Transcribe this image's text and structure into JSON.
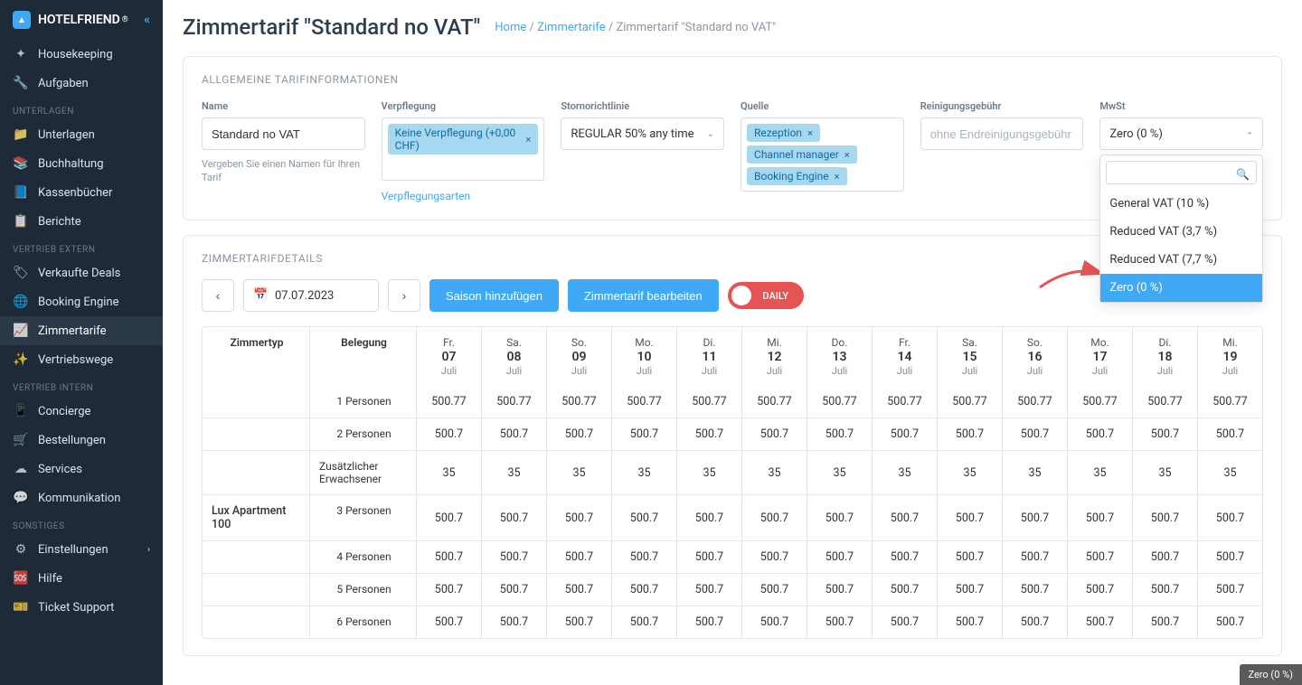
{
  "brand": "HOTELFRIEND",
  "sidebar": {
    "items": [
      {
        "icon": "✦",
        "label": "Housekeeping"
      },
      {
        "icon": "🔧",
        "label": "Aufgaben"
      }
    ],
    "sections": [
      {
        "title": "UNTERLAGEN",
        "items": [
          {
            "icon": "📁",
            "label": "Unterlagen"
          },
          {
            "icon": "📚",
            "label": "Buchhaltung"
          },
          {
            "icon": "📘",
            "label": "Kassenbücher"
          },
          {
            "icon": "📋",
            "label": "Berichte"
          }
        ]
      },
      {
        "title": "VERTRIEB EXTERN",
        "items": [
          {
            "icon": "🏷",
            "label": "Verkaufte Deals"
          },
          {
            "icon": "🌐",
            "label": "Booking Engine"
          },
          {
            "icon": "📈",
            "label": "Zimmertarife",
            "active": true
          },
          {
            "icon": "✨",
            "label": "Vertriebswege"
          }
        ]
      },
      {
        "title": "VERTRIEB INTERN",
        "items": [
          {
            "icon": "📱",
            "label": "Concierge"
          },
          {
            "icon": "🛒",
            "label": "Bestellungen"
          },
          {
            "icon": "☁",
            "label": "Services"
          },
          {
            "icon": "💬",
            "label": "Kommunikation"
          }
        ]
      },
      {
        "title": "SONSTIGES",
        "items": [
          {
            "icon": "⚙",
            "label": "Einstellungen",
            "chevron": true
          },
          {
            "icon": "🆘",
            "label": "Hilfe"
          },
          {
            "icon": "🎫",
            "label": "Ticket Support"
          }
        ]
      }
    ]
  },
  "page": {
    "title": "Zimmertarif \"Standard no VAT\"",
    "breadcrumb": {
      "home": "Home",
      "l1": "Zimmertarife",
      "l2": "Zimmertarif \"Standard no VAT\""
    }
  },
  "panel1": {
    "title": "ALLGEMEINE TARIFINFORMATIONEN",
    "name_label": "Name",
    "name_value": "Standard no VAT",
    "name_hint": "Vergeben Sie einen Namen für Ihren Tarif",
    "meal_label": "Verpflegung",
    "meal_tag": "Keine Verpflegung (+0,00 CHF)",
    "meal_link": "Verpflegungsarten",
    "cancel_label": "Stornorichtlinie",
    "cancel_value": "REGULAR 50% any time",
    "source_label": "Quelle",
    "source_tags": [
      "Rezeption",
      "Channel manager",
      "Booking Engine"
    ],
    "clean_label": "Reinigungsgebühr",
    "clean_placeholder": "ohne Endreinigungsgebühr",
    "vat_label": "MwSt",
    "vat_value": "Zero (0 %)",
    "vat_options": [
      "General VAT (10 %)",
      "Reduced VAT (3,7 %)",
      "Reduced VAT (7,7 %)",
      "Zero (0 %)"
    ]
  },
  "panel2": {
    "title": "ZIMMERTARIFDETAILS",
    "date": "07.07.2023",
    "btn_season": "Saison hinzufügen",
    "btn_edit": "Zimmertarif bearbeiten",
    "daily": "DAILY",
    "col_roomtype": "Zimmertyp",
    "col_occ": "Belegung",
    "days": [
      {
        "dow": "Fr.",
        "num": "07",
        "month": "Juli"
      },
      {
        "dow": "Sa.",
        "num": "08",
        "month": "Juli"
      },
      {
        "dow": "So.",
        "num": "09",
        "month": "Juli"
      },
      {
        "dow": "Mo.",
        "num": "10",
        "month": "Juli"
      },
      {
        "dow": "Di.",
        "num": "11",
        "month": "Juli"
      },
      {
        "dow": "Mi.",
        "num": "12",
        "month": "Juli"
      },
      {
        "dow": "Do.",
        "num": "13",
        "month": "Juli"
      },
      {
        "dow": "Fr.",
        "num": "14",
        "month": "Juli"
      },
      {
        "dow": "Sa.",
        "num": "15",
        "month": "Juli"
      },
      {
        "dow": "So.",
        "num": "16",
        "month": "Juli"
      },
      {
        "dow": "Mo.",
        "num": "17",
        "month": "Juli"
      },
      {
        "dow": "Di.",
        "num": "18",
        "month": "Juli"
      },
      {
        "dow": "Mi.",
        "num": "19",
        "month": "Juli"
      }
    ],
    "roomtype": "Lux Apartment 100",
    "rows": [
      {
        "occ": "1 Personen",
        "vals": [
          "500.77",
          "500.77",
          "500.77",
          "500.77",
          "500.77",
          "500.77",
          "500.77",
          "500.77",
          "500.77",
          "500.77",
          "500.77",
          "500.77",
          "500.77"
        ]
      },
      {
        "occ": "2 Personen",
        "vals": [
          "500.7",
          "500.7",
          "500.7",
          "500.7",
          "500.7",
          "500.7",
          "500.7",
          "500.7",
          "500.7",
          "500.7",
          "500.7",
          "500.7",
          "500.7"
        ]
      },
      {
        "occ": "Zusätzlicher Erwachsener",
        "vals": [
          "35",
          "35",
          "35",
          "35",
          "35",
          "35",
          "35",
          "35",
          "35",
          "35",
          "35",
          "35",
          "35"
        ]
      },
      {
        "occ": "3 Personen",
        "vals": [
          "500.7",
          "500.7",
          "500.7",
          "500.7",
          "500.7",
          "500.7",
          "500.7",
          "500.7",
          "500.7",
          "500.7",
          "500.7",
          "500.7",
          "500.7"
        ]
      },
      {
        "occ": "4 Personen",
        "vals": [
          "500.7",
          "500.7",
          "500.7",
          "500.7",
          "500.7",
          "500.7",
          "500.7",
          "500.7",
          "500.7",
          "500.7",
          "500.7",
          "500.7",
          "500.7"
        ]
      },
      {
        "occ": "5 Personen",
        "vals": [
          "500.7",
          "500.7",
          "500.7",
          "500.7",
          "500.7",
          "500.7",
          "500.7",
          "500.7",
          "500.7",
          "500.7",
          "500.7",
          "500.7",
          "500.7"
        ]
      },
      {
        "occ": "6 Personen",
        "vals": [
          "500.7",
          "500.7",
          "500.7",
          "500.7",
          "500.7",
          "500.7",
          "500.7",
          "500.7",
          "500.7",
          "500.7",
          "500.7",
          "500.7",
          "500.7"
        ]
      }
    ]
  },
  "tooltip": "Zero (0 %)"
}
